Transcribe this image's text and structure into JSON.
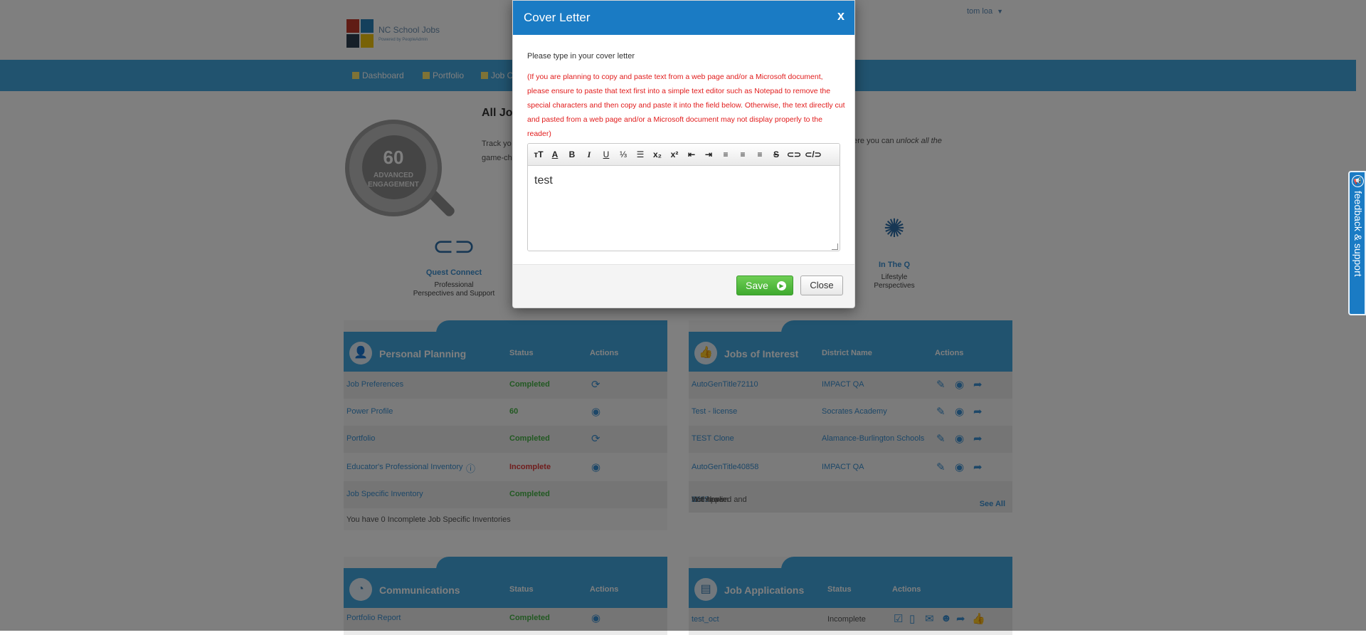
{
  "header": {
    "logo_title": "NC School Jobs",
    "logo_sub": "Powered by PeopleAdmin",
    "user_menu": "tom loa"
  },
  "nav": {
    "items": [
      {
        "label": "Dashboard"
      },
      {
        "label": "Portfolio"
      },
      {
        "label": "Job C"
      }
    ]
  },
  "gauge": {
    "value": "60",
    "label_line1": "ADVANCED",
    "label_line2": "ENGAGEMENT"
  },
  "intro": {
    "title": "All Jo",
    "text_line1": "Track yo",
    "text_line2": "game-ch",
    "text_right_plain": "here you can ",
    "text_right_italic": "unlock all the"
  },
  "features": [
    {
      "title": "Quest Connect",
      "sub1": "Professional",
      "sub2": "Perspectives and Support"
    },
    {
      "title": "In The Q",
      "sub1": "Lifestyle",
      "sub2": "Perspectives"
    }
  ],
  "personal_planning": {
    "title": "Personal Planning",
    "col_status": "Status",
    "col_actions": "Actions",
    "rows": [
      {
        "name": "Job Preferences",
        "status": "Completed"
      },
      {
        "name": "Power Profile",
        "status": "60"
      },
      {
        "name": "Portfolio",
        "status": "Completed"
      },
      {
        "name": "Educator's Professional Inventory",
        "status": "Incomplete"
      },
      {
        "name": "Job Specific Inventory",
        "status": "Completed"
      }
    ],
    "footer": "You have 0 Incomplete Job Specific Inventories"
  },
  "jobs_of_interest": {
    "title": "Jobs of Interest",
    "col_district": "District Name",
    "col_actions": "Actions",
    "rows": [
      {
        "name": "AutoGenTitle72110",
        "district": "IMPACT QA"
      },
      {
        "name": "Test - license",
        "district": "Socrates Academy"
      },
      {
        "name": "TEST Clone",
        "district": "Alamance-Burlington Schools"
      },
      {
        "name": "AutoGenTitle40858",
        "district": "IMPACT QA"
      }
    ],
    "footer_prefix": "You have ",
    "footer_count1": "2285",
    "footer_mid": " Not Applied and ",
    "footer_count2": "5",
    "footer_suffix": " Withdrawn",
    "see_all": "See All"
  },
  "communications": {
    "title": "Communications",
    "col_status": "Status",
    "col_actions": "Actions",
    "rows": [
      {
        "name": "Portfolio Report",
        "status": "Completed"
      }
    ]
  },
  "job_applications": {
    "title": "Job Applications",
    "col_status": "Status",
    "col_actions": "Actions",
    "rows": [
      {
        "name": "test_oct",
        "status": "Incomplete"
      }
    ]
  },
  "feedback": {
    "label": "feedback & support"
  },
  "dialog": {
    "title": "Cover Letter",
    "close_x": "x",
    "prompt": "Please type in your cover letter",
    "warning": "(If you are planning to copy and paste text from a web page and/or a Microsoft document, please ensure to paste that text first into a simple text editor such as Notepad to remove the special characters and then copy and paste it into the field below. Otherwise, the text directly cut and pasted from a web page and/or a Microsoft document may not display properly to the reader)",
    "toolbar": {
      "font_size": "тT",
      "font_color": "A",
      "bold": "B",
      "italic": "I",
      "underline": "U",
      "ordered_list": "⅓",
      "bullet_list": "☰",
      "subscript": "x₂",
      "superscript": "x²",
      "outdent": "⇤",
      "indent": "⇥",
      "align_left": "≡",
      "align_center": "≡",
      "align_right": "≡",
      "strikethrough": "S",
      "link": "⊂⊃",
      "unlink": "⊂/⊃"
    },
    "text": "test",
    "save_label": "Save",
    "close_label": "Close"
  }
}
